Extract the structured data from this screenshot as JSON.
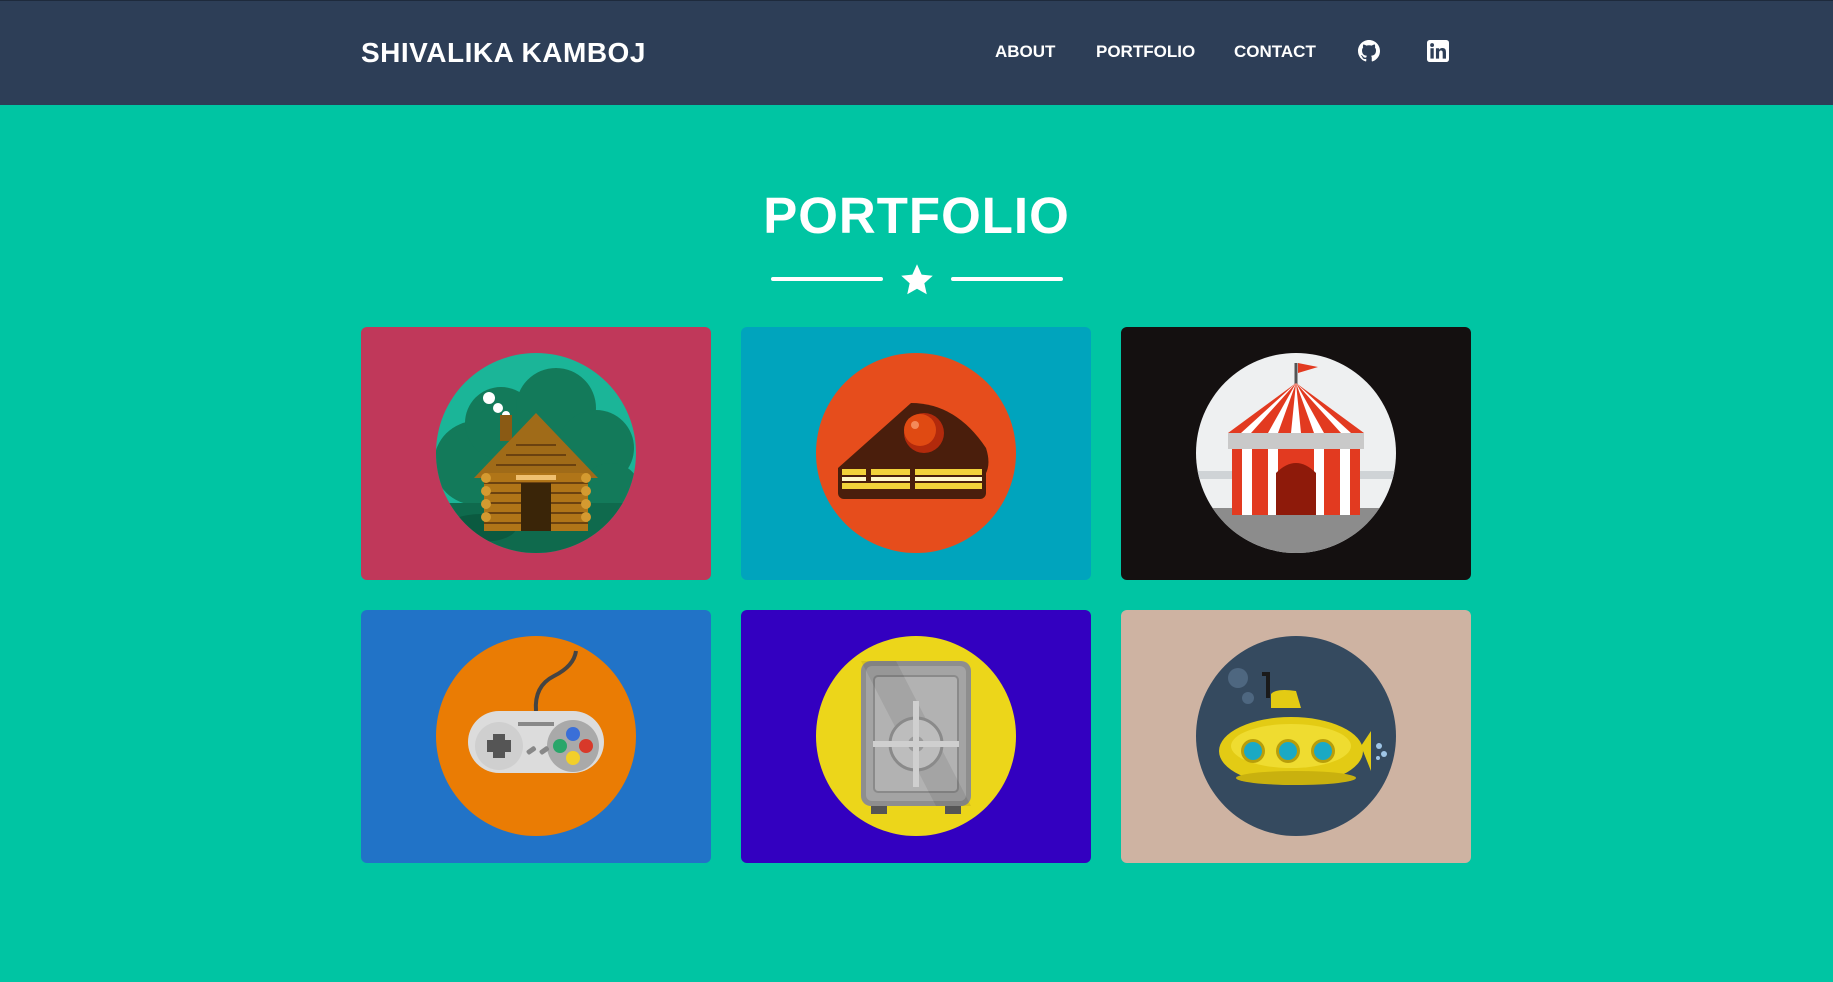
{
  "navbar": {
    "brand": "SHIVALIKA KAMBOJ",
    "links": [
      "ABOUT",
      "PORTFOLIO",
      "CONTACT"
    ],
    "icons": [
      "github-icon",
      "linkedin-icon"
    ],
    "background": "#2d3e57"
  },
  "main": {
    "title": "PORTFOLIO",
    "background": "#00c5a3",
    "items": [
      {
        "icon": "cabin-icon",
        "background": "#c0385a",
        "circle": "#1bb598"
      },
      {
        "icon": "cake-icon",
        "background": "#00a4bd",
        "circle": "#e64d1c"
      },
      {
        "icon": "circus-tent-icon",
        "background": "#141010",
        "circle": "#eef0f1"
      },
      {
        "icon": "game-controller-icon",
        "background": "#2173c7",
        "circle": "#ea7c04"
      },
      {
        "icon": "safe-icon",
        "background": "#3300c0",
        "circle": "#ecd61a"
      },
      {
        "icon": "submarine-icon",
        "background": "#ceb3a2",
        "circle": "#354a5f"
      }
    ]
  }
}
